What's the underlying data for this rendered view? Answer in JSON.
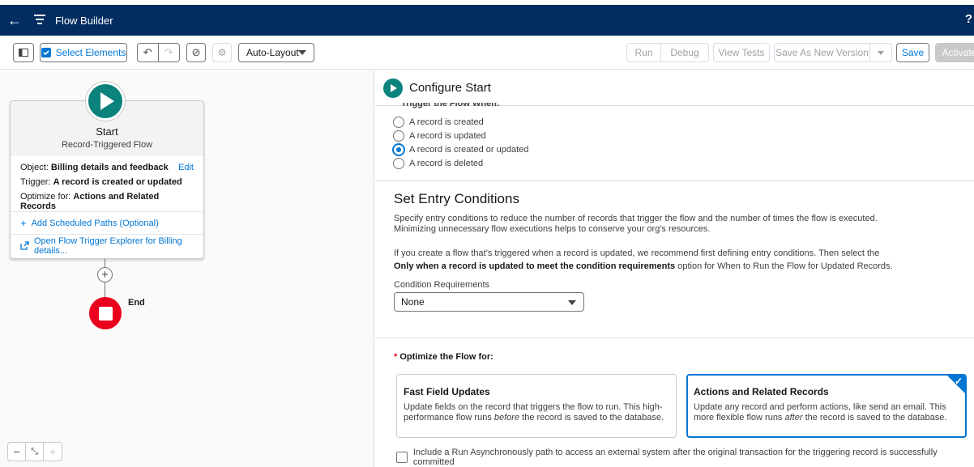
{
  "header": {
    "title": "Flow Builder",
    "help": "?"
  },
  "toolbar": {
    "select_elements": "Select Elements",
    "layout_mode": "Auto-Layout",
    "run": "Run",
    "debug": "Debug",
    "view_tests": "View Tests",
    "save_as_new_version": "Save As New Version",
    "save": "Save",
    "activate": "Activate"
  },
  "canvas": {
    "start": {
      "title": "Start",
      "subtitle": "Record-Triggered Flow",
      "object_label": "Object:",
      "object_value": "Billing details and feedback",
      "edit": "Edit",
      "trigger_label": "Trigger:",
      "trigger_value": "A record is created or updated",
      "optimize_label": "Optimize for:",
      "optimize_value": "Actions and Related Records",
      "add_scheduled_paths": "Add Scheduled Paths (Optional)",
      "open_explorer": "Open Flow Trigger Explorer for Billing details..."
    },
    "end_label": "End"
  },
  "panel": {
    "title": "Configure Start",
    "trigger_heading": "Trigger the Flow When:",
    "trigger_options": [
      {
        "label": "A record is created",
        "selected": false
      },
      {
        "label": "A record is updated",
        "selected": false
      },
      {
        "label": "A record is created or updated",
        "selected": true
      },
      {
        "label": "A record is deleted",
        "selected": false
      }
    ],
    "entry": {
      "title": "Set Entry Conditions",
      "desc1_line1": "Specify entry conditions to reduce the number of records that trigger the flow and the number of times the flow is executed.",
      "desc1_line2": "Minimizing unnecessary flow executions helps to conserve your org's resources.",
      "desc2_line1": "If you create a flow that's triggered when a record is updated, we recommend first defining entry conditions. Then select the",
      "desc2_bold": "Only when a record is updated to meet the condition requirements",
      "desc2_rest": " option for When to Run the Flow for Updated Records.",
      "condition_label": "Condition Requirements",
      "condition_value": "None"
    },
    "optimize": {
      "required_mark": "*",
      "label": "Optimize the Flow for:",
      "fast": {
        "title": "Fast Field Updates",
        "line1": "Update fields on the record that triggers the flow to run. This high-",
        "line2_pre": "performance flow runs ",
        "line2_em": "before",
        "line2_post": " the record is saved to the database."
      },
      "actions": {
        "title": "Actions and Related Records",
        "line1": "Update any record and perform actions, like send an email. This",
        "line2_pre": "more flexible flow runs ",
        "line2_em": "after",
        "line2_post": " the record is saved to the database.",
        "selected": true
      }
    },
    "async_label": "Include a Run Asynchronously path to access an external system after the original transaction for the triggering record is successfully committed"
  },
  "colors": {
    "header_bg": "#032d60",
    "brand": "#0176d3",
    "start_green": "#0b827c",
    "end_red": "#ea001e"
  }
}
